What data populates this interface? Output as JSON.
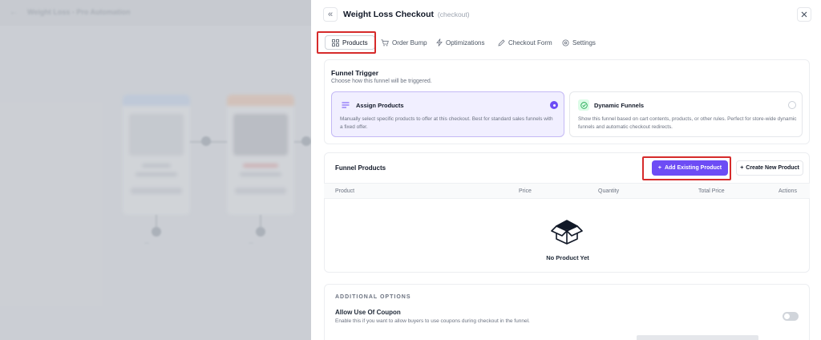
{
  "background": {
    "title": "Weight Loss - Pro Automation",
    "step_a_label": "Landing",
    "step_b_label": "Checkout",
    "step_a_name": "Landing",
    "step_b_name": "Checkout"
  },
  "panel": {
    "title": "Weight Loss Checkout",
    "subtitle": "(checkout)"
  },
  "tabs": [
    {
      "label": "Products",
      "icon": "grid-icon",
      "active": true
    },
    {
      "label": "Order Bump",
      "icon": "cart-icon",
      "active": false
    },
    {
      "label": "Optimizations",
      "icon": "bolt-icon",
      "active": false
    },
    {
      "label": "Checkout Form",
      "icon": "pen-icon",
      "active": false
    },
    {
      "label": "Settings",
      "icon": "gear-icon",
      "active": false
    }
  ],
  "funnel_trigger": {
    "title": "Funnel Trigger",
    "description": "Choose how this funnel will be triggered.",
    "options": [
      {
        "title": "Assign Products",
        "desc_line1": "Manually select specific products to offer at this checkout. Best for standard sales funnels with",
        "desc_line2": "a fixed offer.",
        "selected": true
      },
      {
        "title": "Dynamic Funnels",
        "desc_line1": "Show this funnel based on cart contents, products, or other rules. Perfect for store-wide dynamic",
        "desc_line2": "funnels and automatic checkout redirects.",
        "selected": false
      }
    ]
  },
  "funnel_products": {
    "title": "Funnel Products",
    "add_existing_label": "Add Existing Product",
    "create_new_label": "Create New Product",
    "columns": [
      "Product",
      "Price",
      "Quantity",
      "Total Price",
      "Actions"
    ],
    "empty_text": "No Product Yet"
  },
  "additional_options": {
    "heading": "ADDITIONAL OPTIONS",
    "coupon_title": "Allow Use Of Coupon",
    "coupon_desc": "Enable this if you want to allow buyers to use coupons during checkout in the funnel.",
    "coupon_enabled": false
  },
  "colors": {
    "primary": "#6d4cf5",
    "highlight": "#d62b2b",
    "selected_bg": "#f1efff"
  }
}
